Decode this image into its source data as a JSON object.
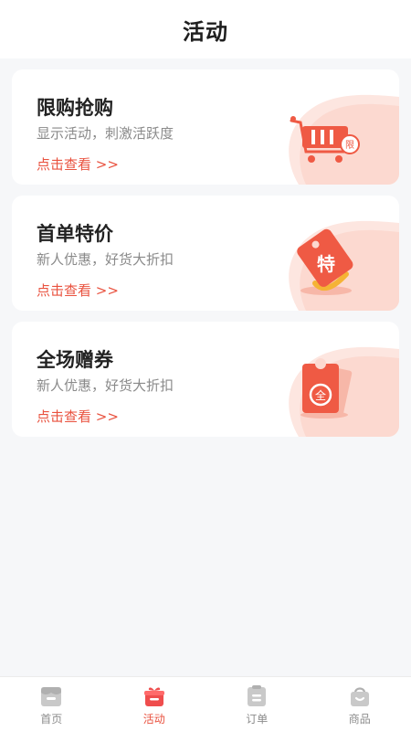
{
  "header": {
    "title": "活动"
  },
  "cards": [
    {
      "title": "限购抢购",
      "subtitle": "显示活动，刺激活跃度",
      "link": "点击查看 >>",
      "icon": "cart-limited-icon"
    },
    {
      "title": "首单特价",
      "subtitle": "新人优惠，好货大折扣",
      "link": "点击查看 >>",
      "icon": "special-price-tag-icon"
    },
    {
      "title": "全场赠券",
      "subtitle": "新人优惠，好货大折扣",
      "link": "点击查看 >>",
      "icon": "coupon-ticket-icon"
    }
  ],
  "tabbar": {
    "items": [
      {
        "label": "首页",
        "icon": "home-store-icon",
        "active": false
      },
      {
        "label": "活动",
        "icon": "gift-icon",
        "active": true
      },
      {
        "label": "订单",
        "icon": "clipboard-icon",
        "active": false
      },
      {
        "label": "商品",
        "icon": "shopping-bag-icon",
        "active": false
      }
    ]
  },
  "colors": {
    "accent": "#e9523f",
    "background": "#f6f7f9",
    "inactive": "#c4c4c4"
  }
}
